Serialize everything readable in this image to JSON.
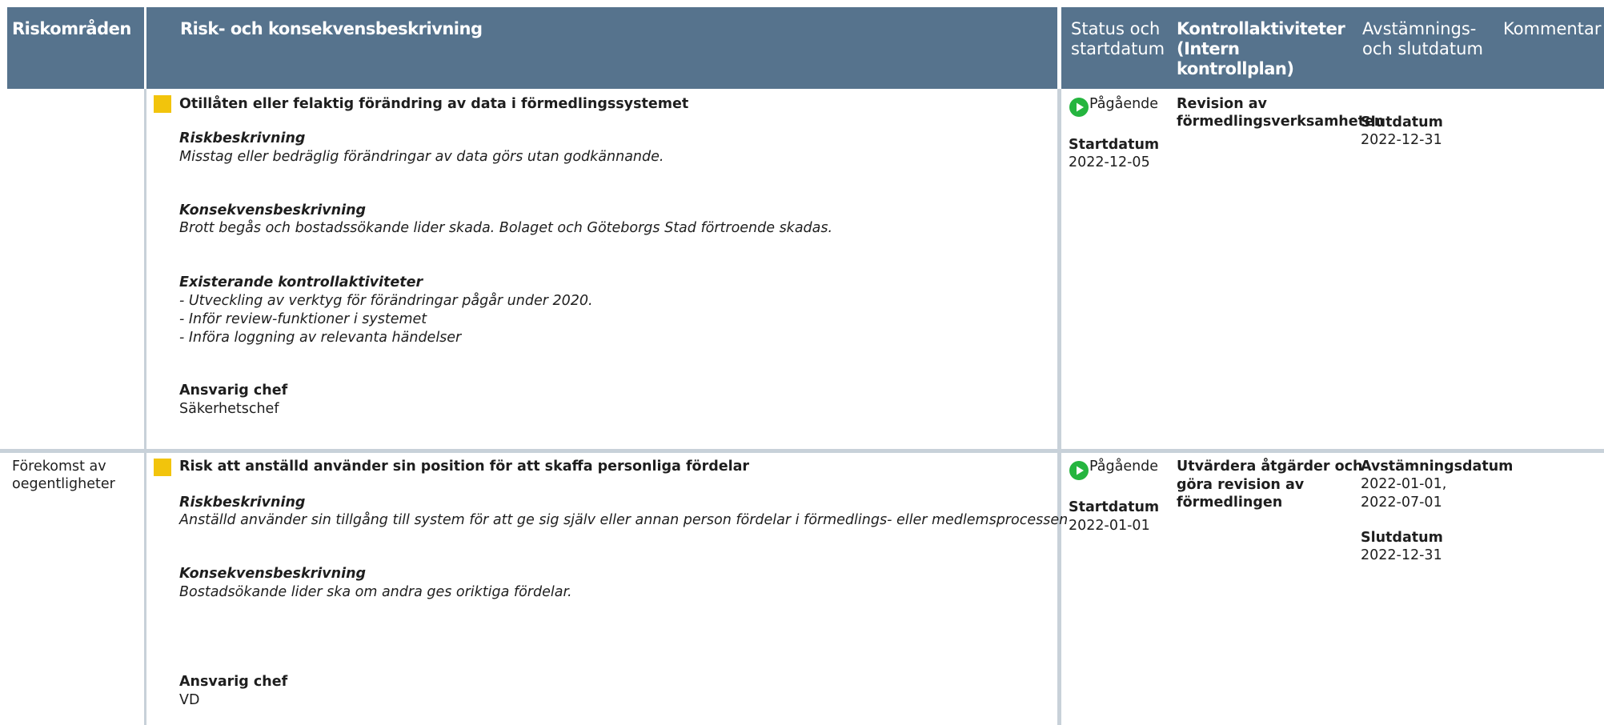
{
  "header": {
    "riskomraden": "Riskområden",
    "beskrivning": "Risk- och konsekvensbeskrivning",
    "status_line1": "Status och",
    "status_line2": "startdatum",
    "kontroll_line1": "Kontrollaktiviteter",
    "kontroll_line2": "(Intern",
    "kontroll_line3": "kontrollplan)",
    "avst_line1": "Avstämnings-",
    "avst_line2": "och slutdatum",
    "kommentar": "Kommentar"
  },
  "rows": [
    {
      "area": "",
      "title": "Otillåten eller felaktig förändring av data i förmedlingssystemet",
      "risk_heading": "Riskbeskrivning",
      "risk_text": "Misstag eller bedräglig förändringar av data görs utan godkännande.",
      "cons_heading": "Konsekvensbeskrivning",
      "cons_text": "Brott begås och bostadssökande lider skada. Bolaget och Göteborgs Stad  förtroende skadas.",
      "exist_heading": "Existerande kontrollaktiviteter",
      "exist_lines": [
        "- Utveckling av verktyg för förändringar pågår under 2020.",
        "- Inför review-funktioner i systemet",
        "- Införa loggning av relevanta händelser"
      ],
      "chef_heading": "Ansvarig chef",
      "chef": "Säkerhetschef",
      "status": "Pågående",
      "start_label": "Startdatum",
      "start_date": "2022-12-05",
      "activity_lines": [
        "Revision av",
        "förmedlingsverksamheten"
      ],
      "slut_label": "Slutdatum",
      "slut_date": "2022-12-31"
    },
    {
      "area_line1": "Förekomst av",
      "area_line2": "oegentligheter",
      "title": "Risk att anställd använder sin position för att skaffa personliga fördelar",
      "risk_heading": "Riskbeskrivning",
      "risk_text": "Anställd använder sin tillgång till system för att ge sig själv eller annan person fördelar i förmedlings- eller medlemsprocessen",
      "cons_heading": "Konsekvensbeskrivning",
      "cons_text": "Bostadsökande lider ska om andra ges oriktiga fördelar.",
      "chef_heading": "Ansvarig chef",
      "chef": "VD",
      "status": "Pågående",
      "start_label": "Startdatum",
      "start_date": "2022-01-01",
      "activity_lines": [
        "Utvärdera åtgärder och",
        "göra  revision av",
        "förmedlingen"
      ],
      "avst_label": "Avstämningsdatum",
      "avst_line1": "2022-01-01,",
      "avst_line2": "2022-07-01",
      "slut_label": "Slutdatum",
      "slut_date": "2022-12-31"
    }
  ],
  "colors": {
    "header_bg": "#56738d",
    "header_text": "#ffffff",
    "divider": "#c8d1d9",
    "flag": "#f2c40c",
    "status_green": "#25b53f"
  },
  "icons": {
    "flag": "square-flag-icon",
    "status": "play-circle-icon"
  }
}
